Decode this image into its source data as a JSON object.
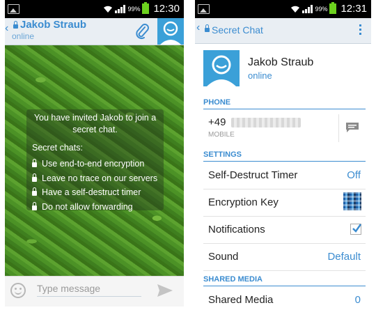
{
  "status_bar": {
    "battery": "99%",
    "left_time": "12:30",
    "right_time": "12:31"
  },
  "chat": {
    "name": "Jakob Straub",
    "status": "online",
    "invite_text": "You have invited Jakob to join a secret chat.",
    "features_title": "Secret chats:",
    "features": [
      "Use end-to-end encryption",
      "Leave no trace on our servers",
      "Have a self-destruct timer",
      "Do not allow forwarding"
    ],
    "input_placeholder": "Type message"
  },
  "profile": {
    "header_title": "Secret Chat",
    "name": "Jakob Straub",
    "status": "online",
    "phone_section": "PHONE",
    "phone_prefix": "+49",
    "phone_type": "MOBILE",
    "settings_section": "SETTINGS",
    "settings": {
      "timer_label": "Self-Destruct Timer",
      "timer_value": "Off",
      "key_label": "Encryption Key",
      "notifications_label": "Notifications",
      "notifications_on": true,
      "sound_label": "Sound",
      "sound_value": "Default"
    },
    "media_section": "SHARED MEDIA",
    "media_label": "Shared Media",
    "media_count": "0"
  },
  "colors": {
    "accent": "#3b8cd0",
    "header_bg": "#e9eef3",
    "avatar": "#3ba0d8",
    "battery": "#6cd11e"
  },
  "icons": [
    "image-icon",
    "wifi-icon",
    "signal-icon",
    "battery-icon",
    "back-chevron-icon",
    "lock-icon",
    "paperclip-icon",
    "avatar-icon",
    "smiley-icon",
    "send-icon",
    "overflow-menu-icon",
    "message-icon",
    "qr-key-icon",
    "checkbox-icon"
  ]
}
